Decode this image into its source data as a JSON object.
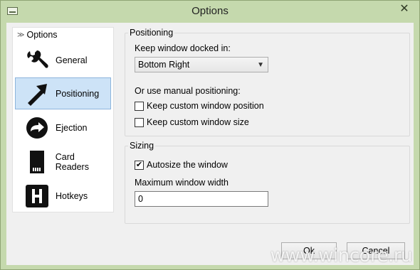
{
  "window": {
    "title": "Options"
  },
  "nav": {
    "header": "Options",
    "items": [
      {
        "label": "General",
        "icon": "wrench-icon"
      },
      {
        "label": "Positioning",
        "icon": "arrow-icon",
        "selected": true
      },
      {
        "label": "Ejection",
        "icon": "eject-arrow-icon"
      },
      {
        "label": "Card Readers",
        "icon": "sd-card-icon"
      },
      {
        "label": "Hotkeys",
        "icon": "h-key-icon"
      }
    ]
  },
  "positioning": {
    "legend": "Positioning",
    "dock_label": "Keep window docked in:",
    "dock_value": "Bottom Right",
    "manual_label": "Or use manual positioning:",
    "keep_position": {
      "label": "Keep custom window position",
      "checked": false
    },
    "keep_size": {
      "label": "Keep custom window size",
      "checked": false
    }
  },
  "sizing": {
    "legend": "Sizing",
    "autosize": {
      "label": "Autosize the window",
      "checked": true
    },
    "max_width_label": "Maximum window width",
    "max_width_value": "0"
  },
  "buttons": {
    "ok": "Ok",
    "cancel": "Cancel"
  },
  "watermark": "www.wincore.ru"
}
